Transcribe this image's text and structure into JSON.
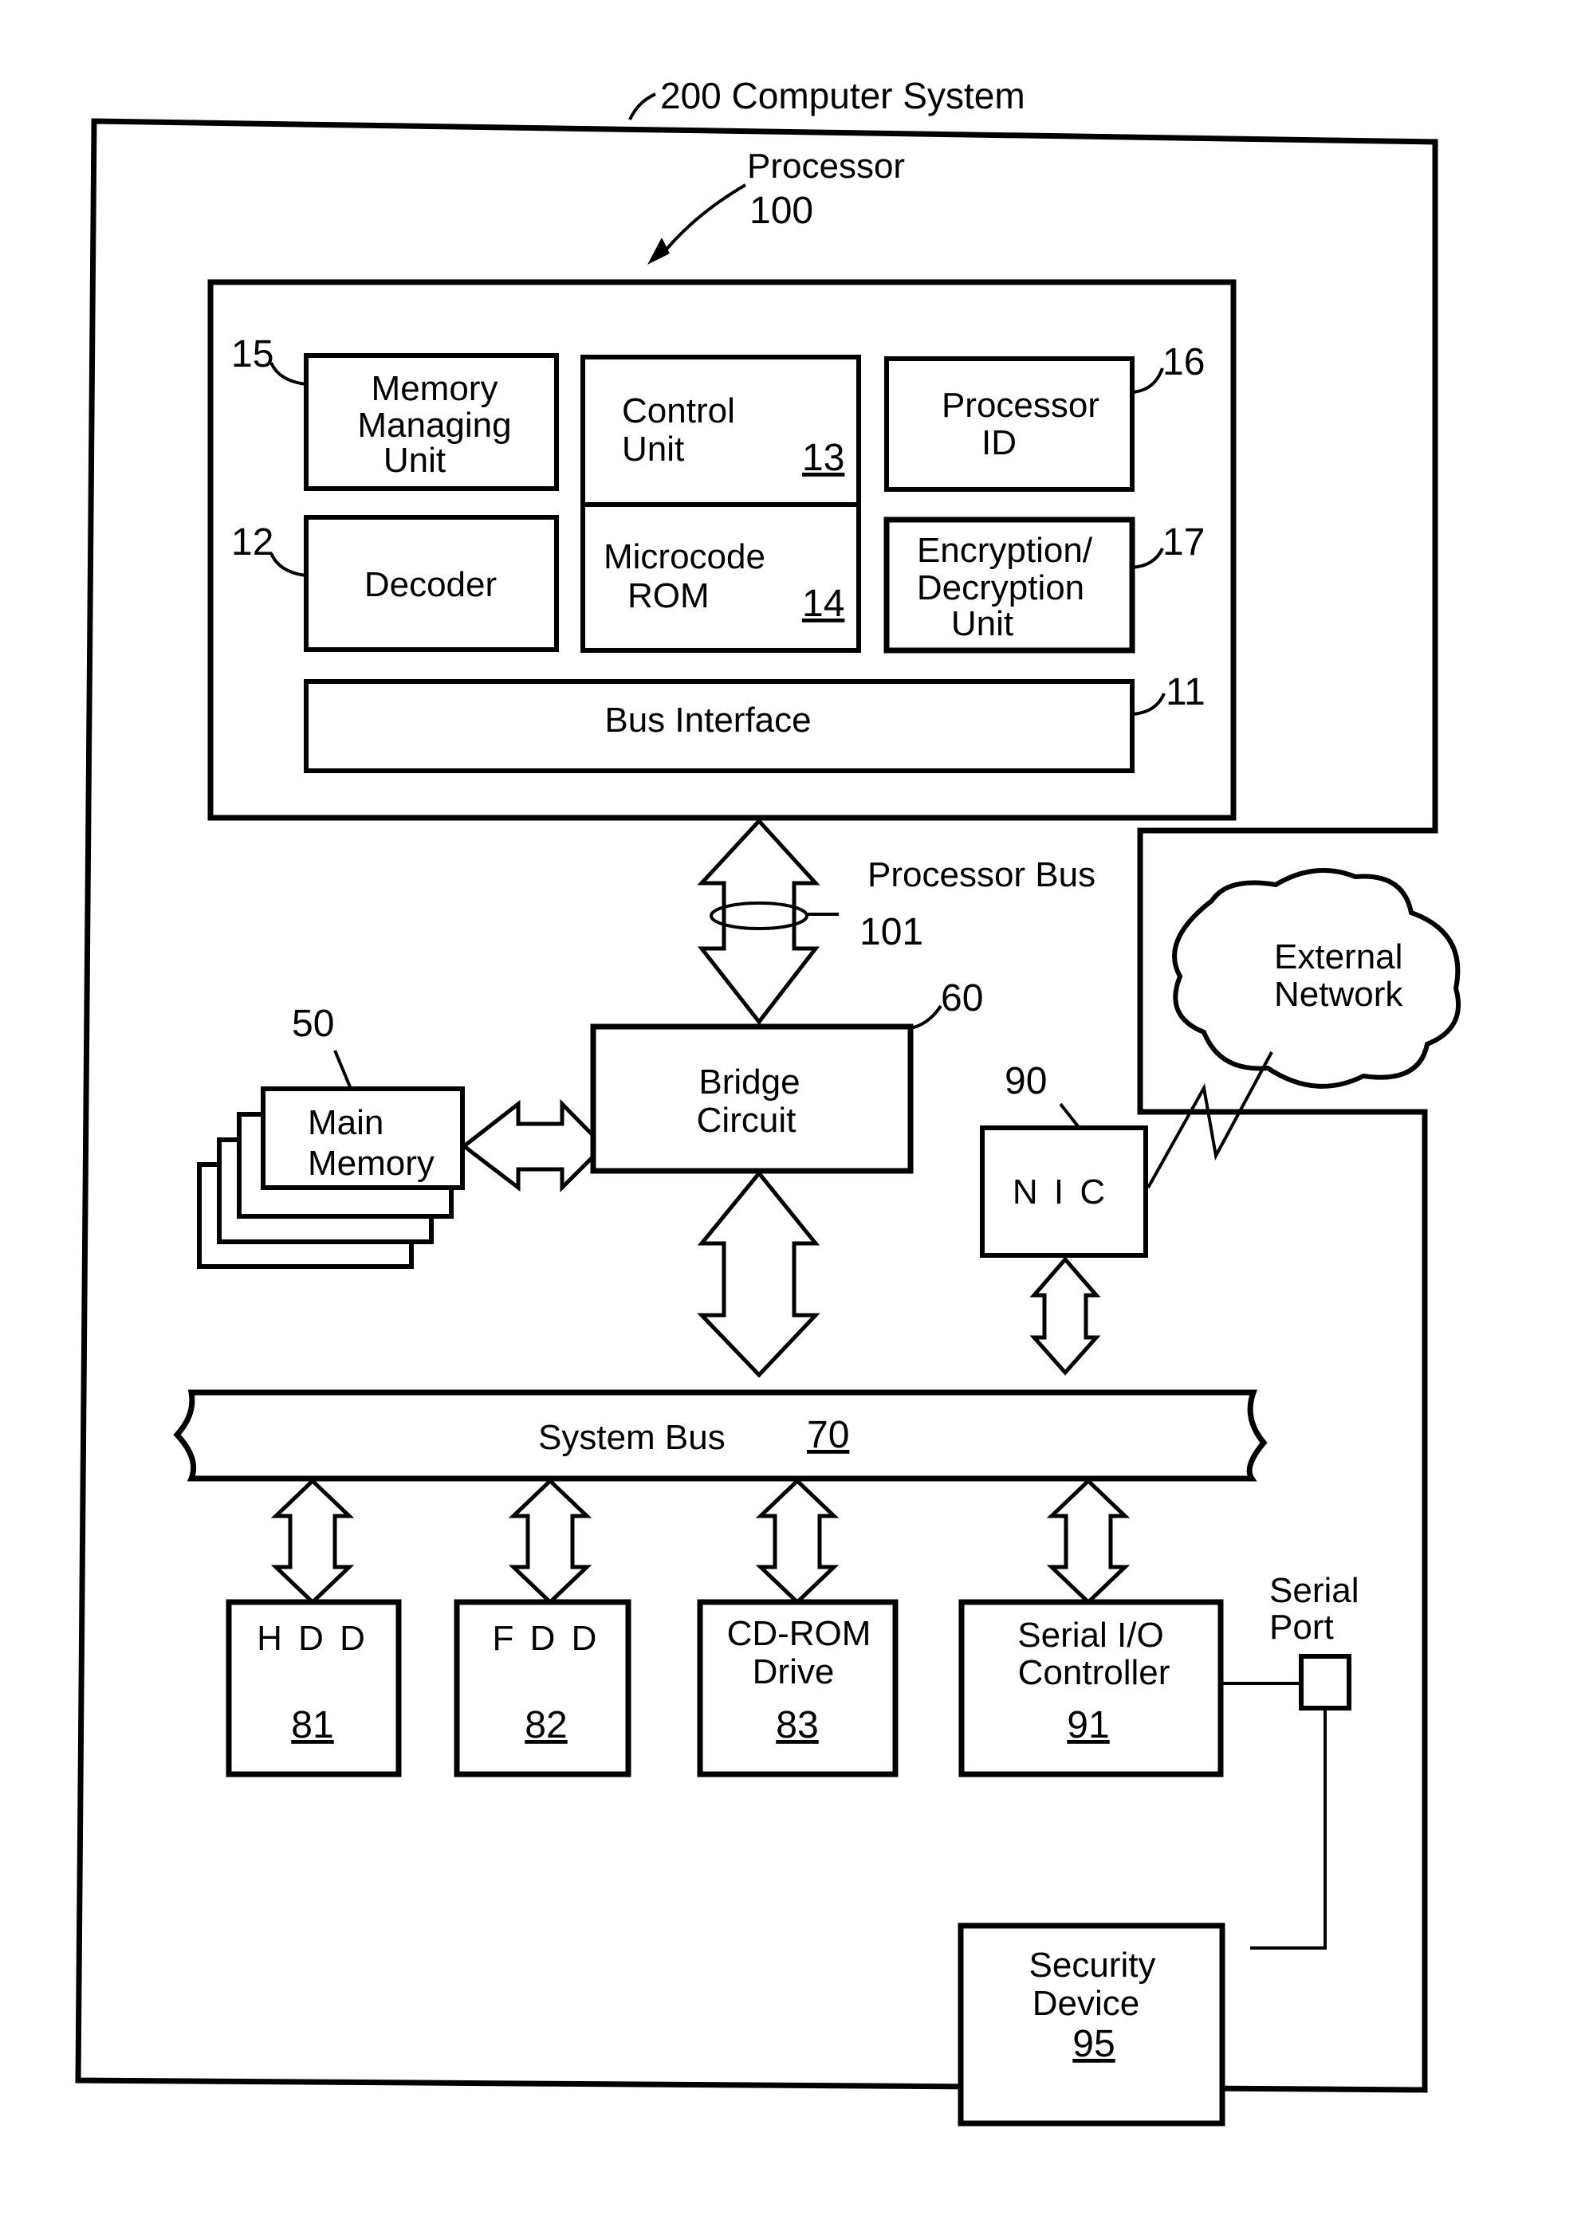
{
  "figure": {
    "system": {
      "ref": "200",
      "label": "Computer System"
    },
    "processor": {
      "label": "Processor",
      "ref": "100",
      "units": {
        "mmu": {
          "ref": "15",
          "lines": [
            "Memory",
            "Managing",
            "Unit"
          ]
        },
        "control_unit": {
          "ref": "13",
          "lines": [
            "Control",
            "Unit"
          ]
        },
        "processor_id": {
          "ref": "16",
          "lines": [
            "Processor",
            "ID"
          ]
        },
        "decoder": {
          "ref": "12",
          "lines": [
            "Decoder"
          ]
        },
        "microcode_rom": {
          "ref": "14",
          "lines": [
            "Microcode",
            "ROM"
          ]
        },
        "encryption_unit": {
          "ref": "17",
          "lines": [
            "Encryption/",
            "Decryption",
            "Unit"
          ]
        },
        "bus_interface": {
          "ref": "11",
          "lines": [
            "Bus Interface"
          ]
        }
      }
    },
    "processor_bus": {
      "label": "Processor Bus",
      "ref": "101"
    },
    "main_memory": {
      "ref": "50",
      "lines": [
        "Main",
        "Memory"
      ]
    },
    "bridge": {
      "ref": "60",
      "lines": [
        "Bridge",
        "Circuit"
      ]
    },
    "external_network": {
      "lines": [
        "External",
        "Network"
      ]
    },
    "nic": {
      "ref": "90",
      "label": "N I C"
    },
    "system_bus": {
      "label": "System Bus",
      "ref": "70"
    },
    "devices": [
      {
        "name": "hdd",
        "lines": [
          "H D D"
        ],
        "ref": "81"
      },
      {
        "name": "fdd",
        "lines": [
          "F D D"
        ],
        "ref": "82"
      },
      {
        "name": "cdrom",
        "lines": [
          "CD-ROM",
          "Drive"
        ],
        "ref": "83"
      },
      {
        "name": "serial-io",
        "lines": [
          "Serial I/O",
          "Controller"
        ],
        "ref": "91"
      }
    ],
    "serial_port": {
      "lines": [
        "Serial",
        "Port"
      ]
    },
    "security_device": {
      "ref": "95",
      "lines": [
        "Security",
        "Device"
      ]
    }
  }
}
